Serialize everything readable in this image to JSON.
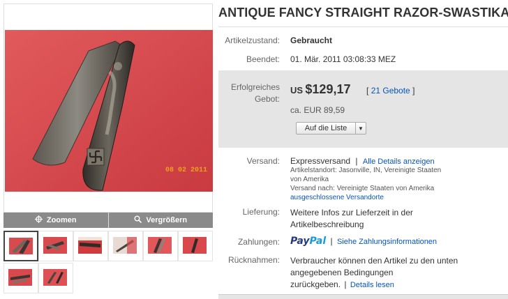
{
  "gallery": {
    "zoom_label": "Zoomen",
    "enlarge_label": "Vergrößern",
    "photo_stamp": "08 02 2011",
    "thumbnail_count": 8
  },
  "listing": {
    "title": "ANTIQUE FANCY STRAIGHT RAZOR-SWASTIKA",
    "condition_label": "Artikelzustand:",
    "condition_value": "Gebraucht",
    "ended_label": "Beendet:",
    "ended_value": "01. Mär. 2011 03:08:33 MEZ",
    "winning_bid_label_line1": "Erfolgreiches",
    "winning_bid_label_line2": "Gebot:",
    "currency": "US",
    "price": "$129,17",
    "bids_open": "[",
    "bids_link": "21 Gebote",
    "bids_close": "]",
    "approx_price": "ca. EUR 89,59",
    "watch_button": "Auf die Liste",
    "shipping_label": "Versand:",
    "shipping_value": "Expressversand",
    "shipping_sep": "|",
    "shipping_details_link": "Alle Details anzeigen",
    "item_location_line1": "Artikelstandort: Jasonville, IN, Vereinigte Staaten",
    "item_location_line2": "von Amerika",
    "ships_to": "Versand nach: Vereinigte Staaten von Amerika",
    "excluded_link": "ausgeschlossene Versandorte",
    "delivery_label": "Lieferung:",
    "delivery_line1": "Weitere Infos zur Lieferzeit in der",
    "delivery_line2": "Artikelbeschreibung",
    "payments_label": "Zahlungen:",
    "paypal_logo": "PayPal",
    "payment_sep": "|",
    "payment_info_link": "Siehe Zahlungsinformationen",
    "returns_label": "Rücknahmen:",
    "returns_line1": "Verbraucher können den Artikel zu den unten",
    "returns_line2": "angegebenen Bedingungen",
    "returns_line3": "zurückgeben.",
    "returns_sep": "|",
    "returns_details_link": "Details lesen"
  },
  "colors": {
    "link": "#0654ba",
    "toolbar": "#8a8a8a",
    "bid_box": "#e5e5e5",
    "photo_bg": "#d8484c",
    "paypal_dark": "#253b80",
    "paypal_light": "#179bd7"
  },
  "icons": [
    "zoom-crosshair-icon",
    "magnifier-icon",
    "dropdown-arrow-icon"
  ]
}
